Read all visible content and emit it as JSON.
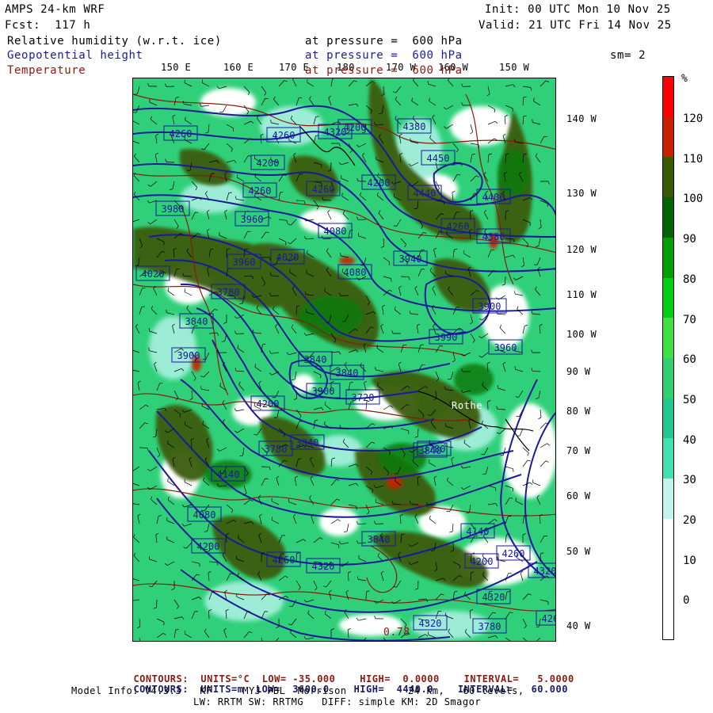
{
  "header": {
    "model": "AMPS 24-km WRF",
    "forecast": "Fcst:  117 h",
    "init": "Init: 00 UTC Mon 10 Nov 25",
    "valid": "Valid: 21 UTC Fri 14 Nov 25",
    "fields": [
      {
        "name": "Relative humidity (w.r.t. ice)",
        "level": "at pressure =  600 hPa",
        "color": "#000000"
      },
      {
        "name": "Geopotential height",
        "level": "at pressure =  600 hPa",
        "color": "#1a1a9a"
      },
      {
        "name": "Temperature",
        "level": "at pressure =  600 hPa",
        "color": "#8a1a10"
      }
    ],
    "smoothing": "sm= 2"
  },
  "map": {
    "top_longitude_labels": [
      "150 E",
      "160 E",
      "170 E",
      "180",
      "170 W",
      "160 W",
      "150 W"
    ],
    "right_longitude_labels": [
      "140 W",
      "130 W",
      "120 W",
      "110 W",
      "100 W",
      "90 W",
      "80 W",
      "70 W",
      "60 W",
      "50 W",
      "40 W"
    ],
    "height_contour_labels": [
      "4260",
      "4260",
      "4200",
      "4320",
      "4200",
      "4260",
      "4260",
      "3980",
      "3960",
      "4020",
      "3840",
      "3780",
      "3900",
      "3840",
      "3840",
      "3900",
      "3780",
      "3840",
      "3780",
      "4080",
      "4200",
      "4260",
      "4320",
      "4140",
      "4200",
      "4260",
      "4320",
      "4380",
      "4450",
      "4440",
      "4400",
      "4380",
      "4260",
      "4200",
      "3960",
      "4020",
      "4080",
      "4200",
      "3720",
      "3840",
      "4320",
      "4260",
      "4320",
      "3780",
      "3840",
      "3990",
      "3900",
      "3960",
      "4080",
      "3940",
      "4140"
    ],
    "other_labels": [
      "0.78",
      "Rothe"
    ],
    "colors": {
      "ocean_white": "#ffffff",
      "height_contour": "#1a1a9a",
      "temp_contour": "#8a1a10"
    }
  },
  "colorbar": {
    "unit": "%",
    "labels": [
      "120",
      "110",
      "100",
      "90",
      "80",
      "70",
      "60",
      "50",
      "40",
      "30",
      "20",
      "10",
      "0"
    ],
    "bands": [
      "#ff0000",
      "#c82000",
      "#3a5a00",
      "#006400",
      "#00a000",
      "#00d010",
      "#40e040",
      "#30d070",
      "#20c890",
      "#40e0b0",
      "#c0f4ec",
      "#ffffff",
      "#ffffff",
      "#ffffff"
    ]
  },
  "footer": {
    "temp_line": {
      "label": "CONTOURS:  UNITS=°C",
      "low": "LOW= -35.000",
      "high": "HIGH=  0.0000",
      "interval": "INTERVAL=   5.0000"
    },
    "height_line": {
      "label": "CONTOURS:  UNITS=m",
      "low": "LOW=  3600.0",
      "high": "HIGH=  4440.0",
      "interval": "INTERVAL=   60.000"
    },
    "model_info_1": "Model Info: V4.3.3   KF     MYJ PBL  Morrison          24 km,   60 levels,",
    "model_info_2": "LW: RRTM SW: RRTMG   DIFF: simple KM: 2D Smagor"
  }
}
